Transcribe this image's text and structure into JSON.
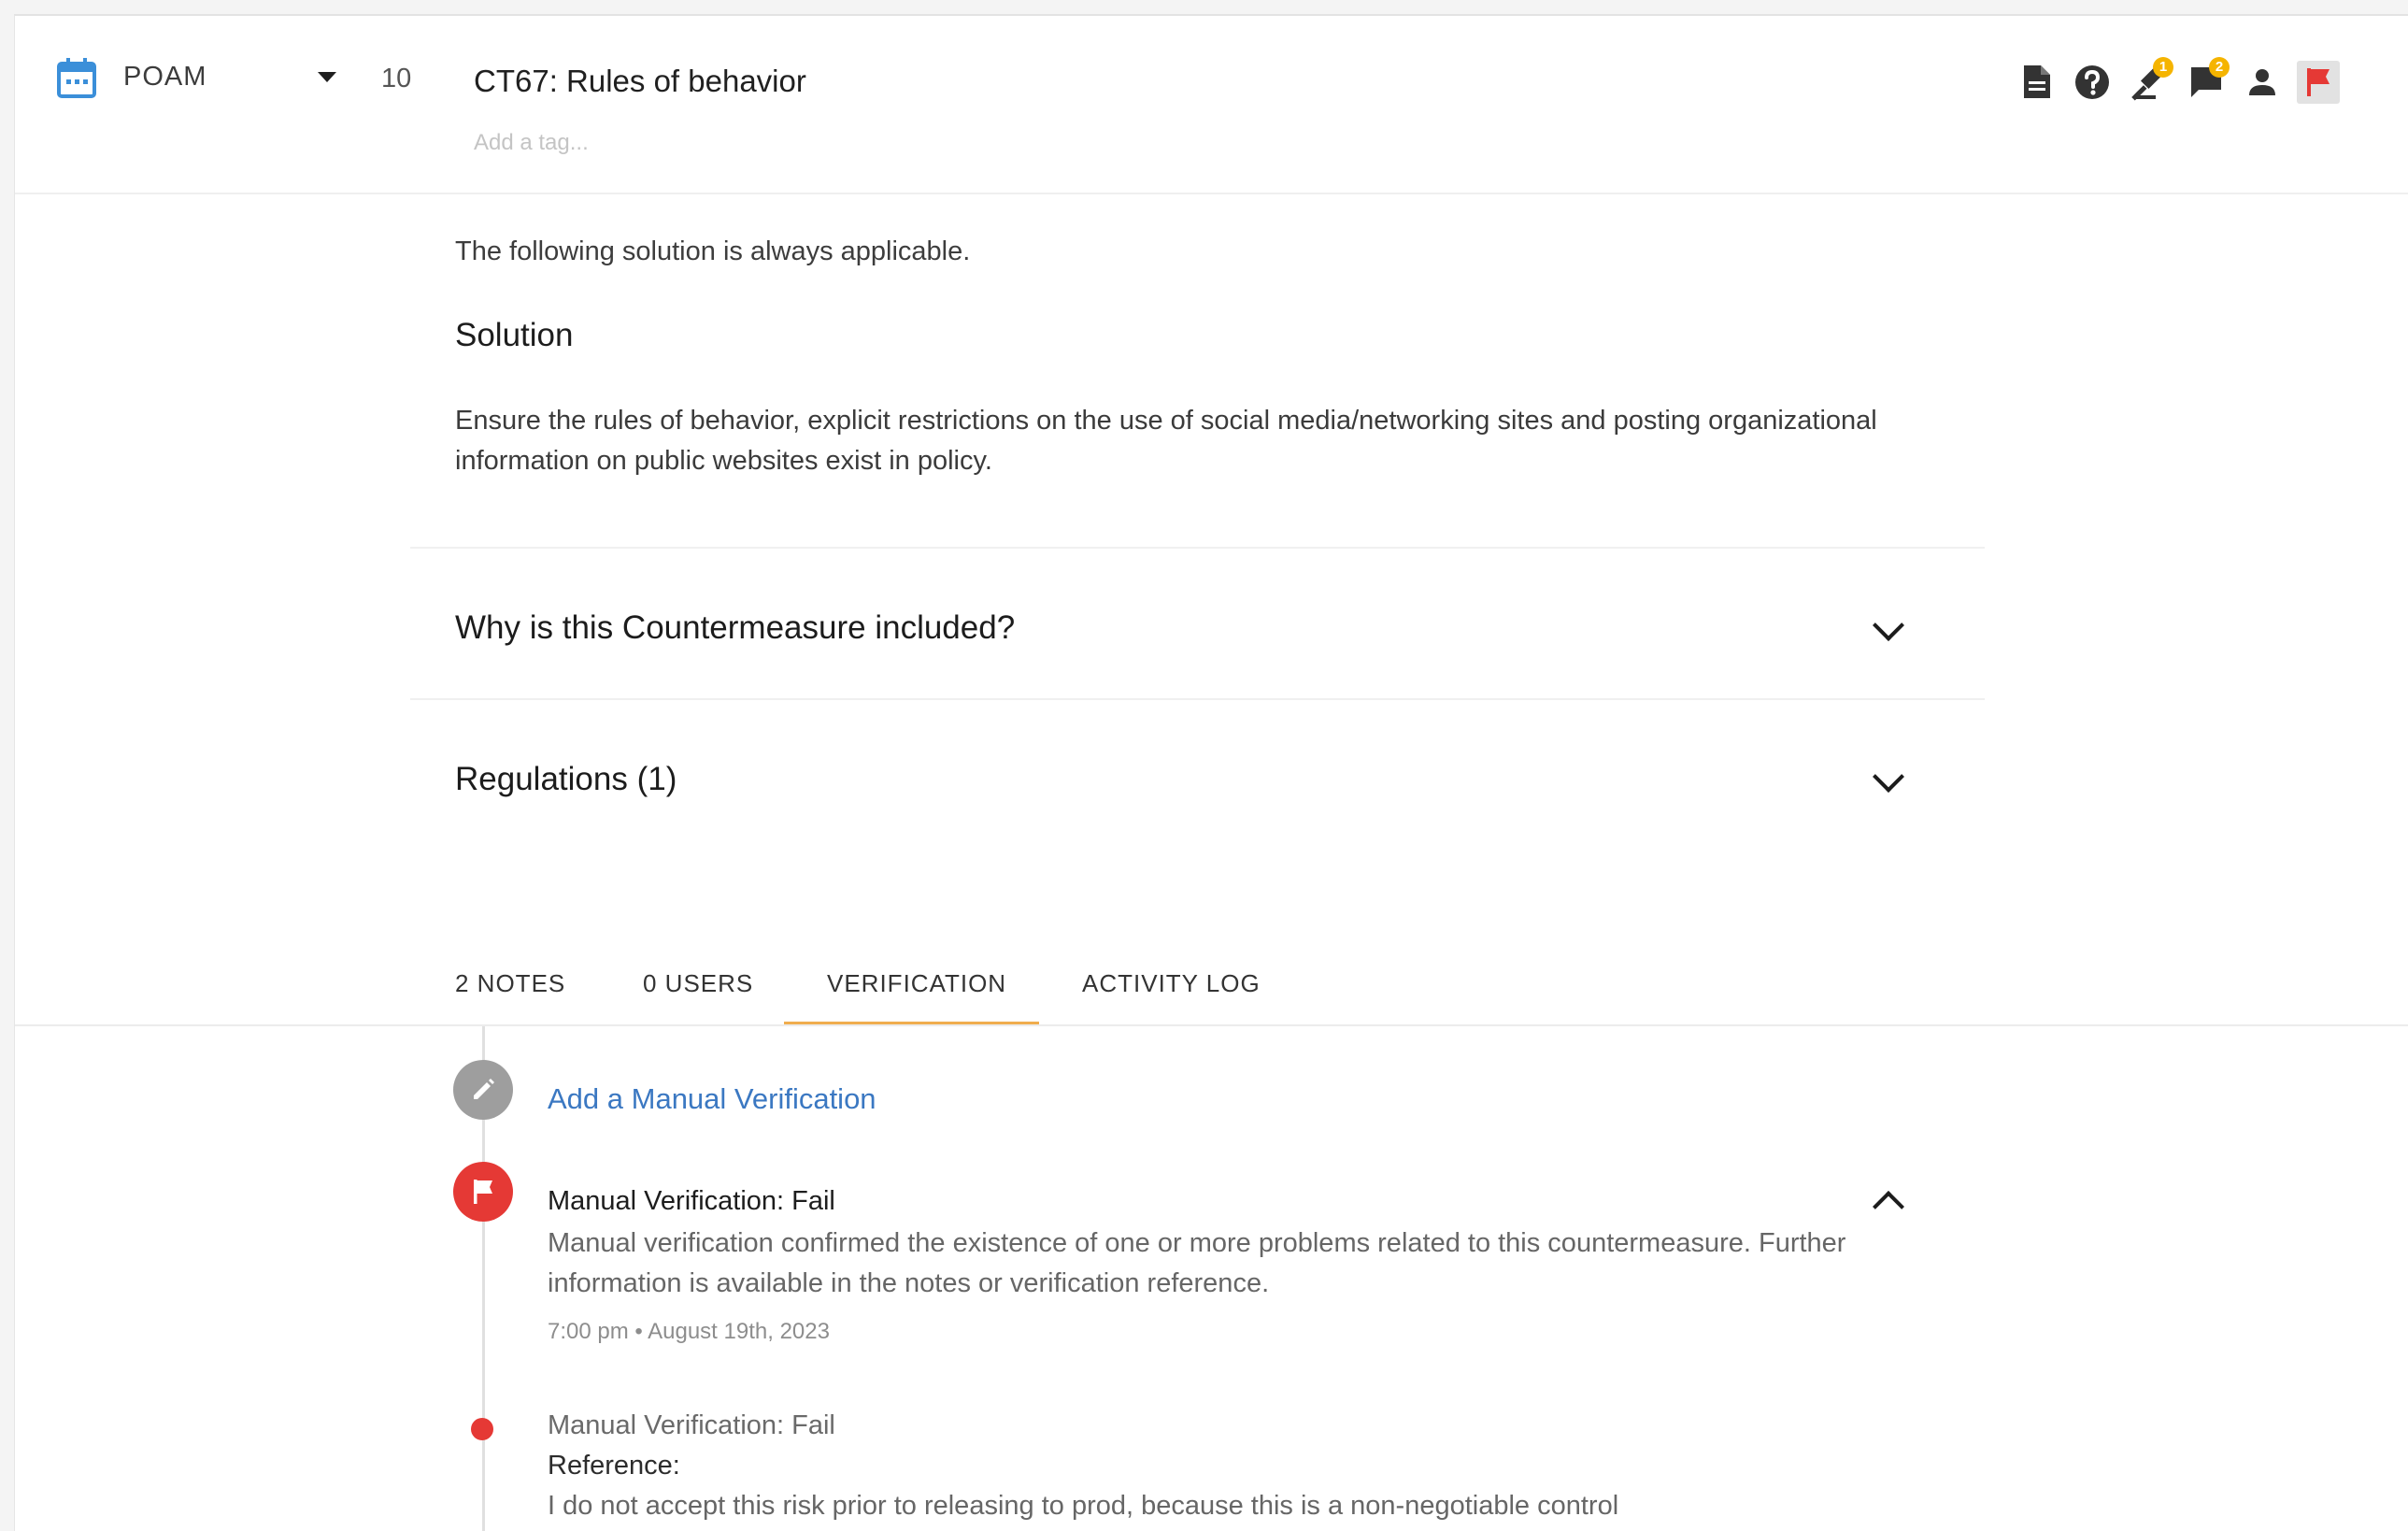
{
  "header": {
    "phase": "POAM",
    "number": "10",
    "title": "CT67: Rules of behavior",
    "tag_placeholder": "Add a tag...",
    "toolbar": [
      {
        "icon": "document-icon"
      },
      {
        "icon": "help-icon"
      },
      {
        "icon": "gavel-icon",
        "badge": "1"
      },
      {
        "icon": "comment-icon",
        "badge": "2"
      },
      {
        "icon": "person-icon"
      },
      {
        "icon": "flag-icon",
        "color": "#e53935"
      }
    ]
  },
  "content": {
    "applicable_text": "The following solution is always applicable.",
    "solution_heading": "Solution",
    "solution_body": "Ensure the rules of behavior, explicit restrictions on the use of social media/networking sites and posting organizational information on public websites exist in policy."
  },
  "accordions": [
    {
      "label": "Why is this Countermeasure included?"
    },
    {
      "label": "Regulations (1)"
    }
  ],
  "tabs": [
    {
      "label": "2 NOTES"
    },
    {
      "label": "0 USERS"
    },
    {
      "label": "VERIFICATION",
      "active": true
    },
    {
      "label": "ACTIVITY LOG"
    }
  ],
  "verification": {
    "add_link": "Add a Manual Verification",
    "entries": [
      {
        "title": "Manual Verification: Fail",
        "description": "Manual verification confirmed the existence of one or more problems related to this countermeasure. Further information is available in the notes or verification reference.",
        "date": "7:00 pm • August 19th, 2023"
      },
      {
        "title": "Manual Verification: Fail",
        "reference_label": "Reference:",
        "reference_text": "I do not accept this risk prior to releasing to prod, because this is a non-negotiable control"
      }
    ]
  },
  "colors": {
    "accent": "#3b78c2",
    "tab_indicator": "#f0ad4e",
    "fail": "#e53935",
    "badge": "#f5b400",
    "calendar": "#3b8fd9"
  }
}
